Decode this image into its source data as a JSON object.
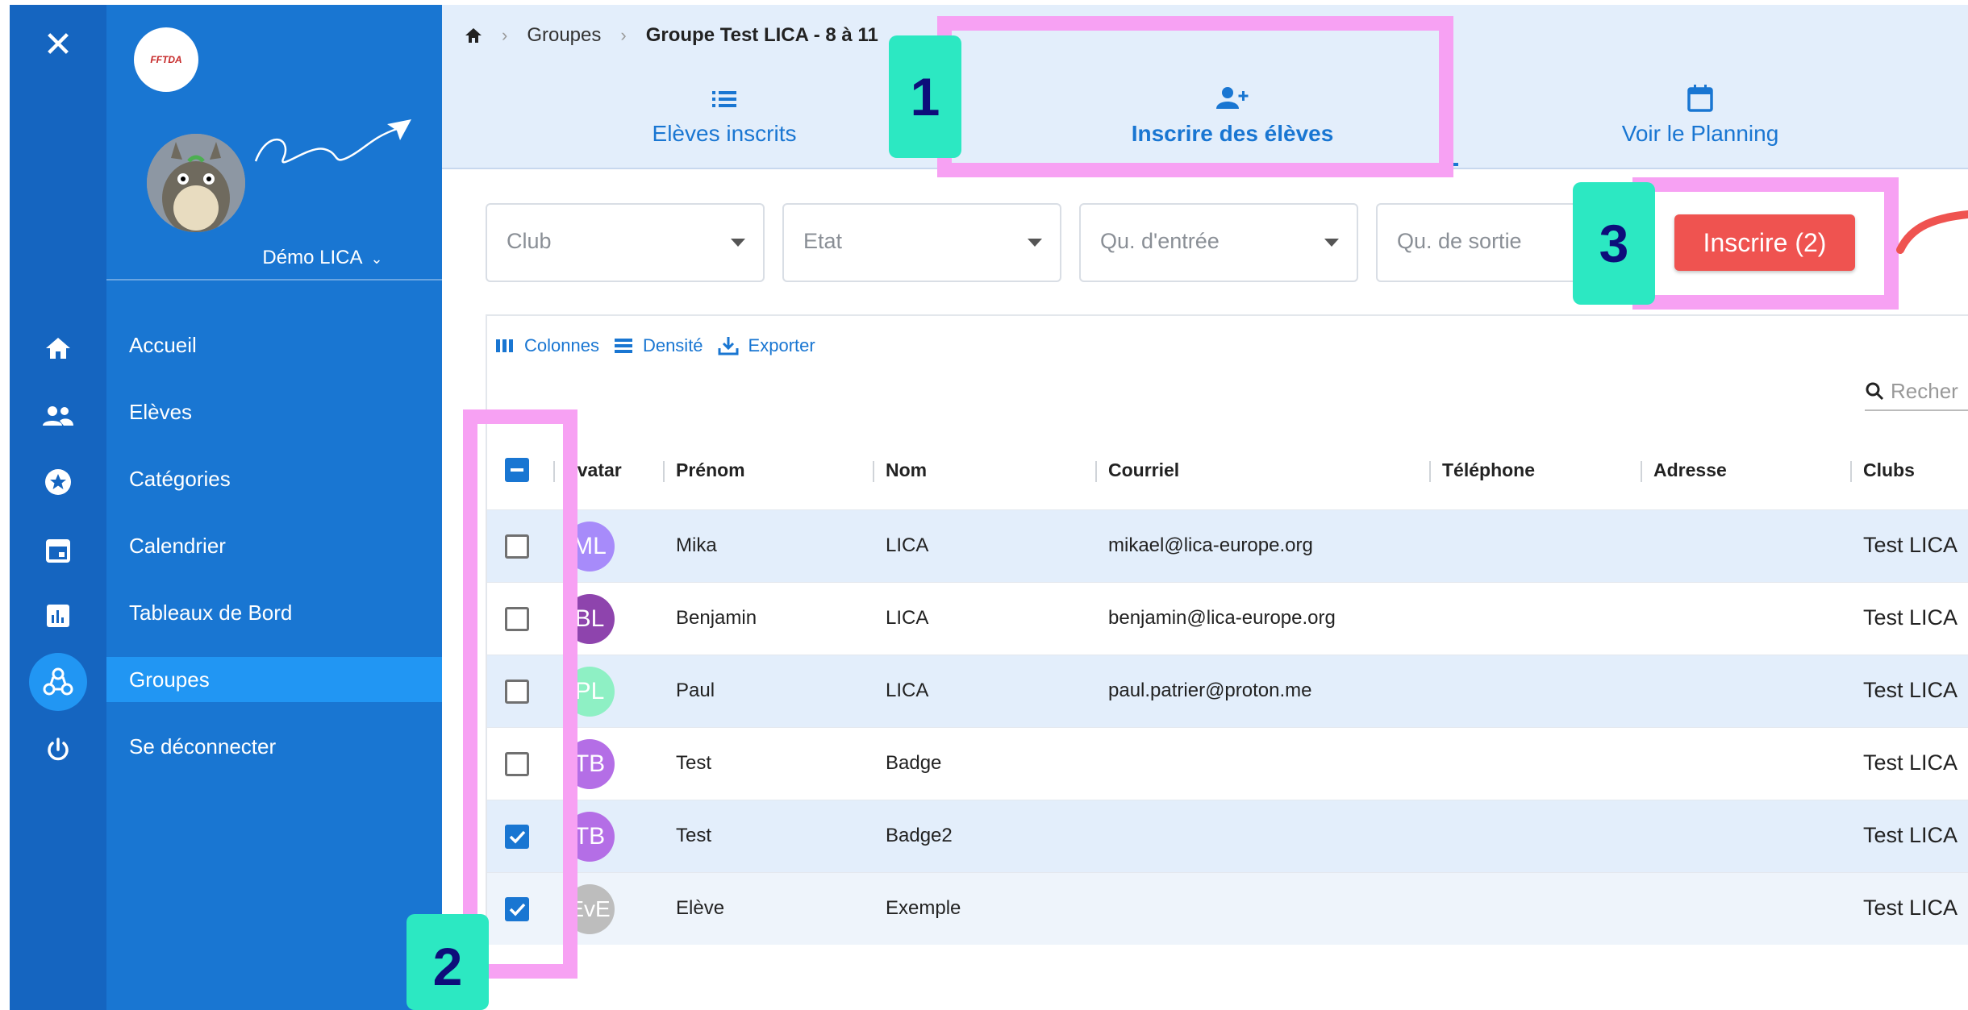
{
  "sidebar": {
    "logo_text": "FFTDA",
    "user_name": "Démo LICA",
    "nav": [
      {
        "label": "Accueil",
        "icon": "home-icon"
      },
      {
        "label": "Elèves",
        "icon": "people-icon"
      },
      {
        "label": "Catégories",
        "icon": "star-circle-icon"
      },
      {
        "label": "Calendrier",
        "icon": "calendar-icon"
      },
      {
        "label": "Tableaux de Bord",
        "icon": "dashboard-icon"
      },
      {
        "label": "Groupes",
        "icon": "groups-icon",
        "active": true
      },
      {
        "label": "Se déconnecter",
        "icon": "power-icon"
      }
    ]
  },
  "breadcrumb": {
    "level1": "Groupes",
    "current": "Groupe Test LICA - 8 à 11"
  },
  "tabs": [
    {
      "label": "Elèves inscrits",
      "icon": "list-icon"
    },
    {
      "label": "Inscrire des élèves",
      "icon": "person-add-icon",
      "active": true
    },
    {
      "label": "Voir le Planning",
      "icon": "calendar-icon"
    }
  ],
  "filters": {
    "club": "Club",
    "etat": "Etat",
    "qu_entree": "Qu. d'entrée",
    "qu_sortie": "Qu. de sortie"
  },
  "actions": {
    "inscrire": "Inscrire (2)"
  },
  "toolbar": {
    "colonnes": "Colonnes",
    "densite": "Densité",
    "exporter": "Exporter",
    "search_placeholder": "Recher"
  },
  "columns": {
    "avatar": "Avatar",
    "prenom": "Prénom",
    "nom": "Nom",
    "courriel": "Courriel",
    "telephone": "Téléphone",
    "adresse": "Adresse",
    "clubs": "Clubs"
  },
  "rows": [
    {
      "initials": "ML",
      "prenom": "Mika",
      "nom": "LICA",
      "courriel": "mikael@lica-europe.org",
      "club": "Test LICA",
      "checked": false,
      "color": "#a78bfa"
    },
    {
      "initials": "BL",
      "prenom": "Benjamin",
      "nom": "LICA",
      "courriel": "benjamin@lica-europe.org",
      "club": "Test LICA",
      "checked": false,
      "color": "#8e44ad"
    },
    {
      "initials": "PL",
      "prenom": "Paul",
      "nom": "LICA",
      "courriel": "paul.patrier@proton.me",
      "club": "Test LICA",
      "checked": false,
      "color": "#8ef0c4"
    },
    {
      "initials": "TB",
      "prenom": "Test",
      "nom": "Badge",
      "courriel": "",
      "club": "Test LICA",
      "checked": false,
      "color": "#b46ee6"
    },
    {
      "initials": "TB",
      "prenom": "Test",
      "nom": "Badge2",
      "courriel": "",
      "club": "Test LICA",
      "checked": true,
      "color": "#b46ee6"
    },
    {
      "initials": "EvE",
      "prenom": "Elève",
      "nom": "Exemple",
      "courriel": "",
      "club": "Test LICA",
      "checked": true,
      "color": "#bdbdbd"
    }
  ],
  "annotations": {
    "m1": "1",
    "m2": "2",
    "m3": "3",
    "highlight_color": "#f7a1f3",
    "marker_color": "#2ce8c2"
  }
}
